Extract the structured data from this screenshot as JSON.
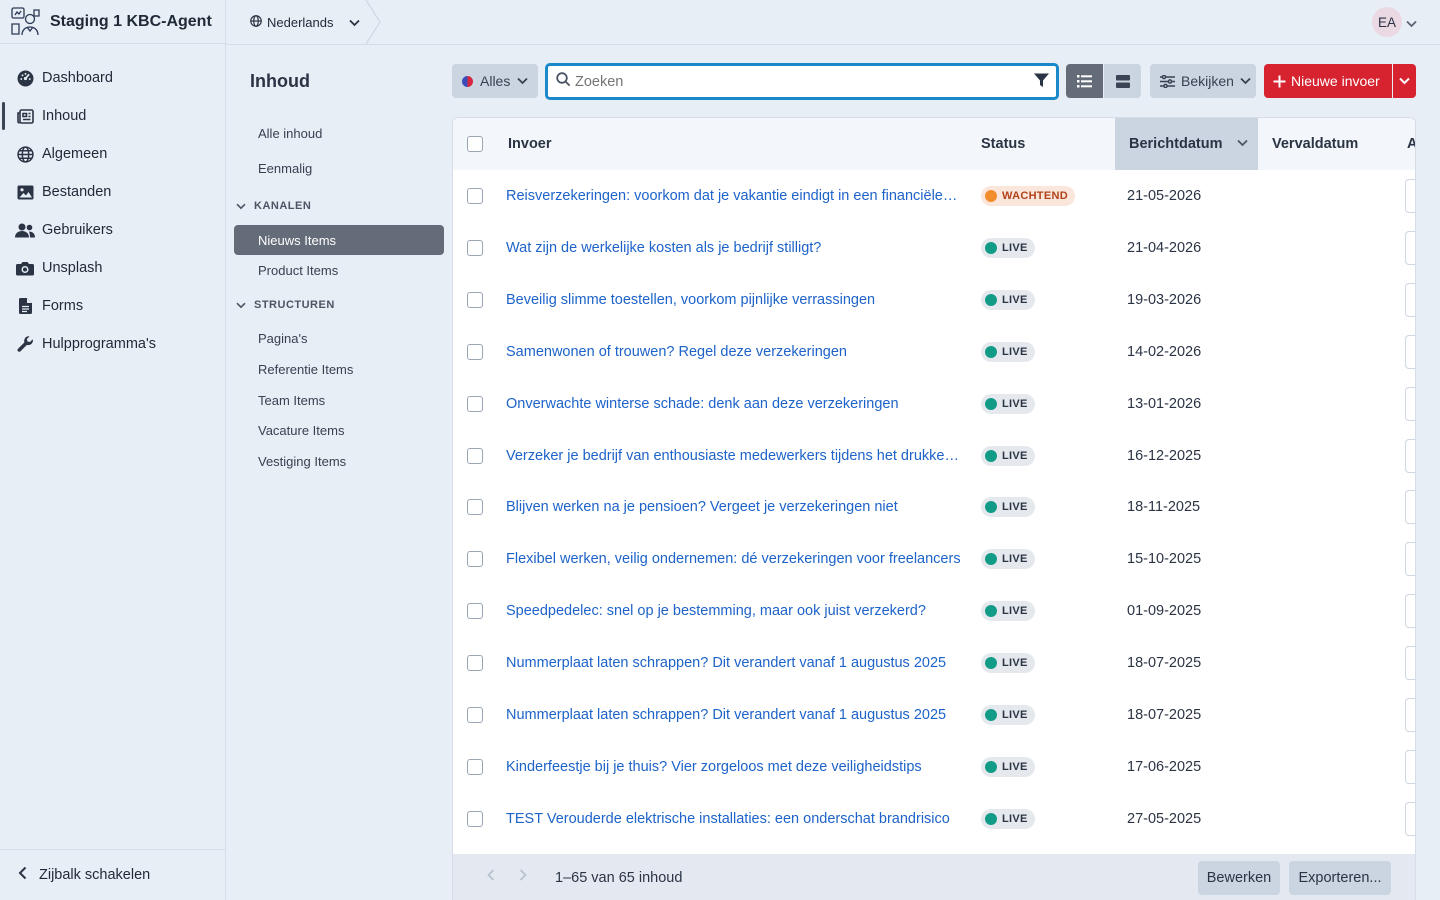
{
  "app": {
    "title": "Staging 1 KBC-Agent"
  },
  "sidebar": {
    "items": [
      {
        "label": "Dashboard",
        "icon": "dashboard-icon"
      },
      {
        "label": "Inhoud",
        "icon": "newspaper-icon",
        "active": true
      },
      {
        "label": "Algemeen",
        "icon": "globe-icon"
      },
      {
        "label": "Bestanden",
        "icon": "image-icon"
      },
      {
        "label": "Gebruikers",
        "icon": "users-icon"
      },
      {
        "label": "Unsplash",
        "icon": "camera-icon"
      },
      {
        "label": "Forms",
        "icon": "file-icon"
      },
      {
        "label": "Hulpprogramma's",
        "icon": "wrench-icon"
      }
    ],
    "toggle_label": "Zijbalk schakelen"
  },
  "topbar": {
    "language": "Nederlands",
    "avatar_initials": "EA"
  },
  "content_nav": {
    "title": "Inhoud",
    "all": "Alle inhoud",
    "single": "Eenmalig",
    "channels_heading": "KANALEN",
    "channels": [
      "Nieuws Items",
      "Product Items"
    ],
    "structures_heading": "STRUCTUREN",
    "structures": [
      "Pagina's",
      "Referentie Items",
      "Team Items",
      "Vacature Items",
      "Vestiging Items"
    ]
  },
  "toolbar": {
    "site_filter": "Alles",
    "search_placeholder": "Zoeken",
    "view_label": "Bekijken",
    "new_label": "Nieuwe invoer"
  },
  "table": {
    "columns": {
      "entry": "Invoer",
      "status": "Status",
      "post_date": "Berichtdatum",
      "expiry_date": "Vervaldatum",
      "cut": "A"
    },
    "rows": [
      {
        "title": "Reisverzekeringen: voorkom dat je vakantie eindigt in een financiële kater",
        "status": "WACHTEND",
        "date": "21-05-2026"
      },
      {
        "title": "Wat zijn de werkelijke kosten als je bedrijf stilligt?",
        "status": "LIVE",
        "date": "21-04-2026"
      },
      {
        "title": "Beveilig slimme toestellen, voorkom pijnlijke verrassingen",
        "status": "LIVE",
        "date": "19-03-2026"
      },
      {
        "title": "Samenwonen of trouwen? Regel deze verzekeringen",
        "status": "LIVE",
        "date": "14-02-2026"
      },
      {
        "title": "Onverwachte winterse schade: denk aan deze verzekeringen",
        "status": "LIVE",
        "date": "13-01-2026"
      },
      {
        "title": "Verzeker je bedrijf van enthousiaste medewerkers tijdens het drukke seizoen",
        "status": "LIVE",
        "date": "16-12-2025"
      },
      {
        "title": "Blijven werken na je pensioen? Vergeet je verzekeringen niet",
        "status": "LIVE",
        "date": "18-11-2025"
      },
      {
        "title": "Flexibel werken, veilig ondernemen: dé verzekeringen voor freelancers",
        "status": "LIVE",
        "date": "15-10-2025"
      },
      {
        "title": "Speedpedelec: snel op je bestemming, maar ook juist verzekerd?",
        "status": "LIVE",
        "date": "01-09-2025"
      },
      {
        "title": "Nummerplaat laten schrappen? Dit verandert vanaf 1 augustus 2025",
        "status": "LIVE",
        "date": "18-07-2025"
      },
      {
        "title": "Nummerplaat laten schrappen? Dit verandert vanaf 1 augustus 2025",
        "status": "LIVE",
        "date": "18-07-2025"
      },
      {
        "title": "Kinderfeestje bij je thuis? Vier zorgeloos met deze veiligheidstips",
        "status": "LIVE",
        "date": "17-06-2025"
      },
      {
        "title": "TEST Verouderde elektrische installaties: een onderschat brandrisico",
        "status": "LIVE",
        "date": "27-05-2025"
      }
    ]
  },
  "footer": {
    "count": "1–65 van 65 inhoud",
    "edit": "Bewerken",
    "export": "Exporteren..."
  },
  "colors": {
    "accent": "#1d63c9",
    "brand_red": "#d7232f",
    "live": "#129c88",
    "pending": "#f28d2e"
  }
}
